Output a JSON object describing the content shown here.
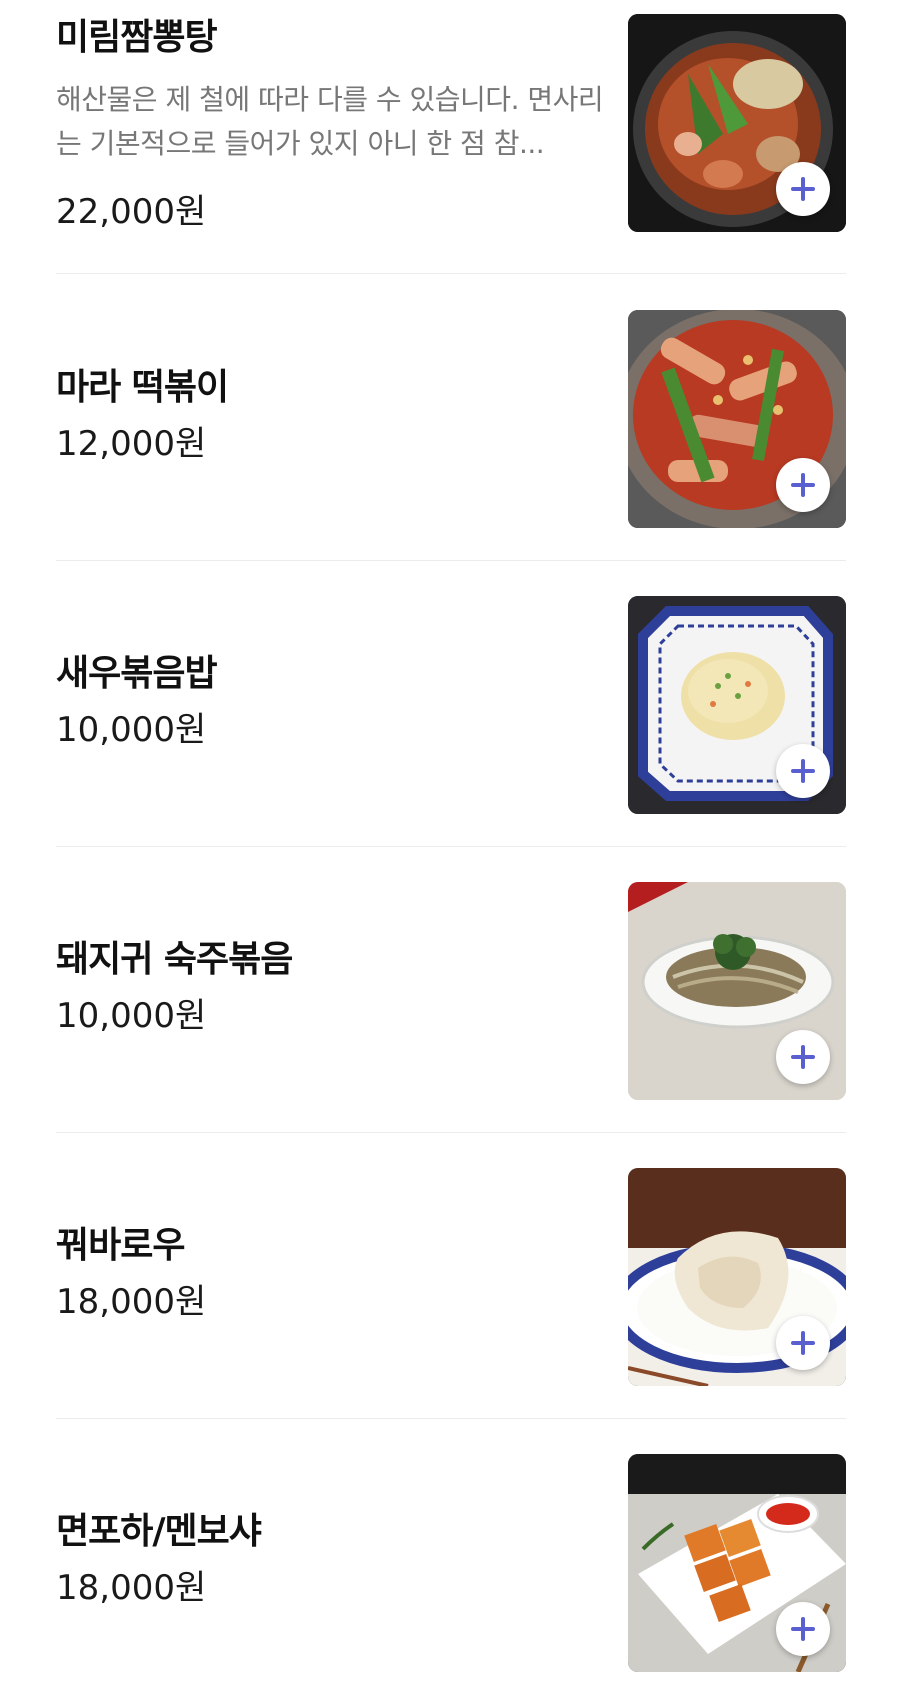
{
  "menu": {
    "items": [
      {
        "name": "미림짬뽕탕",
        "description": "해산물은 제 철에 따라 다를 수 있습니다. 면사리는 기본적으로 들어가 있지 아니 한 점 참...",
        "price": "22,000원",
        "image": "jjambbong-hotpot-photo",
        "add_icon": "plus-icon"
      },
      {
        "name": "마라 떡볶이",
        "price": "12,000원",
        "image": "mala-tteokbokki-photo",
        "add_icon": "plus-icon"
      },
      {
        "name": "새우볶음밥",
        "price": "10,000원",
        "image": "shrimp-fried-rice-photo",
        "add_icon": "plus-icon"
      },
      {
        "name": "돼지귀 숙주볶음",
        "price": "10,000원",
        "image": "pig-ear-bean-sprout-photo",
        "add_icon": "plus-icon"
      },
      {
        "name": "꿔바로우",
        "price": "18,000원",
        "image": "guobaorou-photo",
        "add_icon": "plus-icon"
      },
      {
        "name": "면포하/멘보샤",
        "price": "18,000원",
        "image": "menbosha-photo",
        "add_icon": "plus-icon"
      }
    ]
  },
  "colors": {
    "add_button_icon": "#5a5fd0",
    "description_text": "#777777",
    "divider": "#ececec"
  }
}
